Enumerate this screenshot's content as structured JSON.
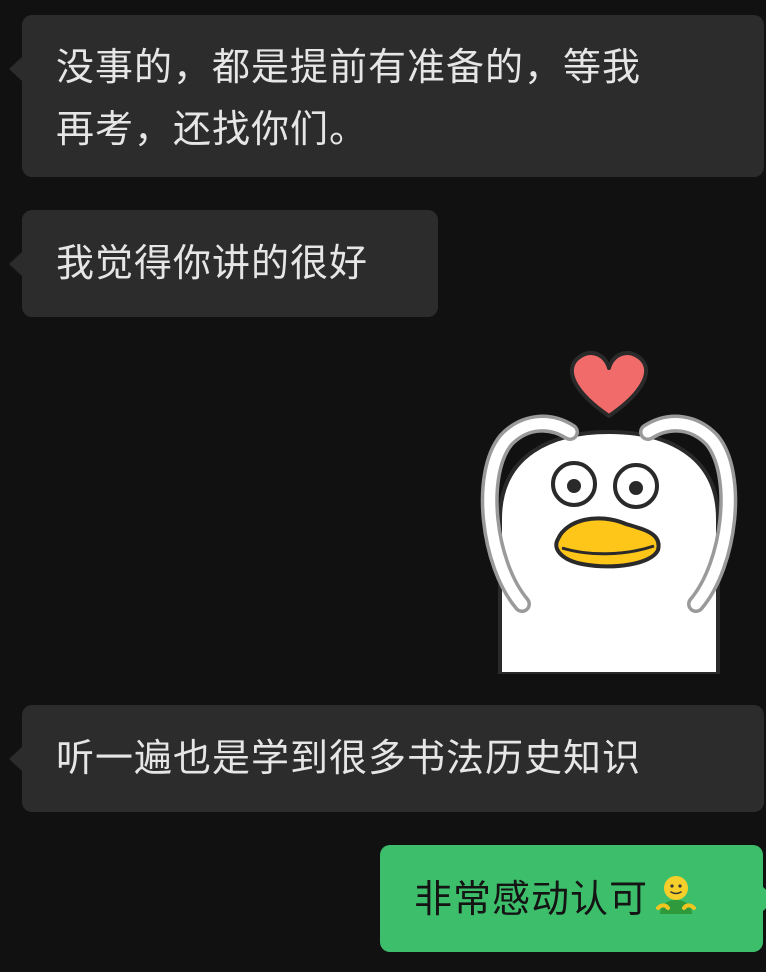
{
  "messages": [
    {
      "direction": "incoming",
      "lines": [
        "没事的，都是提前有准备的，等我",
        "再考，还找你们。"
      ]
    },
    {
      "direction": "incoming",
      "text": "我觉得你讲的很好"
    },
    {
      "direction": "incoming",
      "type": "sticker",
      "sticker": "duck-heart-sticker"
    },
    {
      "direction": "incoming",
      "text": "听一遍也是学到很多书法历史知识"
    },
    {
      "direction": "outgoing",
      "text": "非常感动认可",
      "emoji": "smiley-figure-emoji"
    }
  ],
  "colors": {
    "background": "#111111",
    "incoming_bubble": "#2c2c2c",
    "outgoing_bubble": "#3dbe6b",
    "incoming_text": "#e6e6e6",
    "outgoing_text": "#141414"
  }
}
